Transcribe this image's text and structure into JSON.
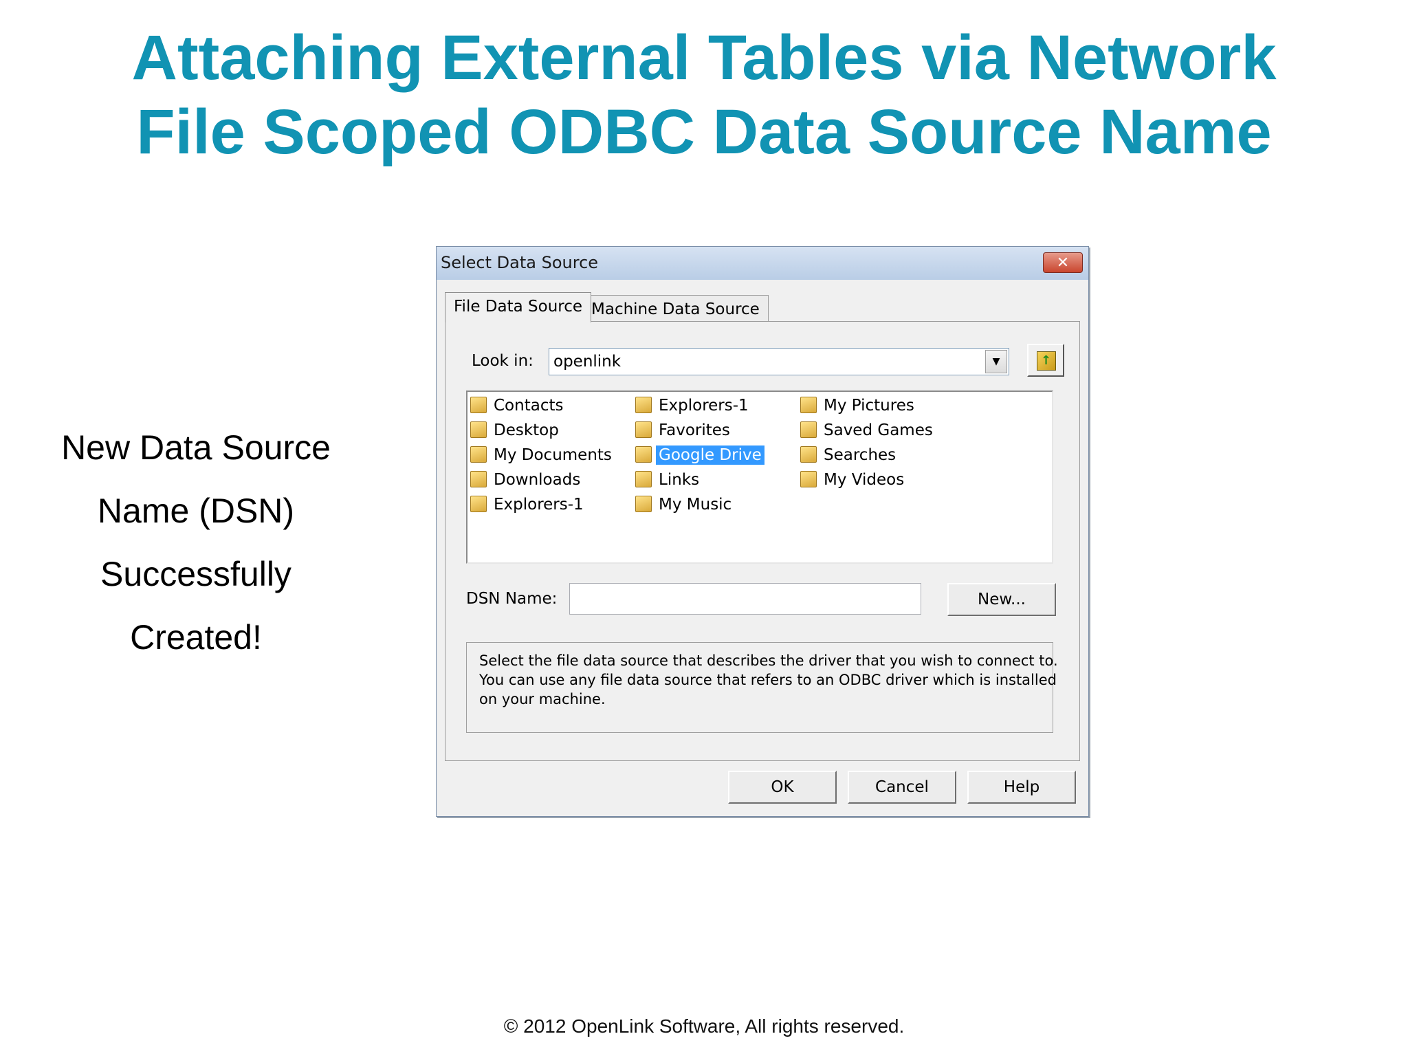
{
  "slide": {
    "title_line1": "Attaching External Tables via Network",
    "title_line2": "File Scoped ODBC Data Source Name",
    "side_lines": [
      "New Data Source",
      "Name (DSN)",
      "Successfully",
      "Created!"
    ],
    "footer": "© 2012 OpenLink Software, All rights reserved."
  },
  "dialog": {
    "title": "Select Data Source",
    "close_glyph": "✕",
    "tabs": [
      {
        "label": "File Data Source",
        "active": true
      },
      {
        "label": "Machine Data Source",
        "active": false
      }
    ],
    "look_in_label": "Look in:",
    "look_in_value": "openlink",
    "dropdown_arrow": "▼",
    "folder_up_glyph": "↑",
    "files": {
      "col1": [
        "Contacts",
        "Desktop",
        "My Documents",
        "Downloads",
        "Explorers-1"
      ],
      "col2": [
        "Explorers-1",
        "Favorites",
        "Google Drive",
        "Links",
        "My Music"
      ],
      "col3": [
        "My Pictures",
        "Saved Games",
        "Searches",
        "My Videos"
      ]
    },
    "selected_file": "Google Drive",
    "dsn_label": "DSN Name:",
    "dsn_value": "",
    "new_button": "New...",
    "description": [
      "Select the file data source that describes the driver that you wish to connect to.",
      "You can use any file data source that refers to an ODBC driver which is installed",
      "on your machine."
    ],
    "buttons": {
      "ok": "OK",
      "cancel": "Cancel",
      "help": "Help"
    }
  }
}
